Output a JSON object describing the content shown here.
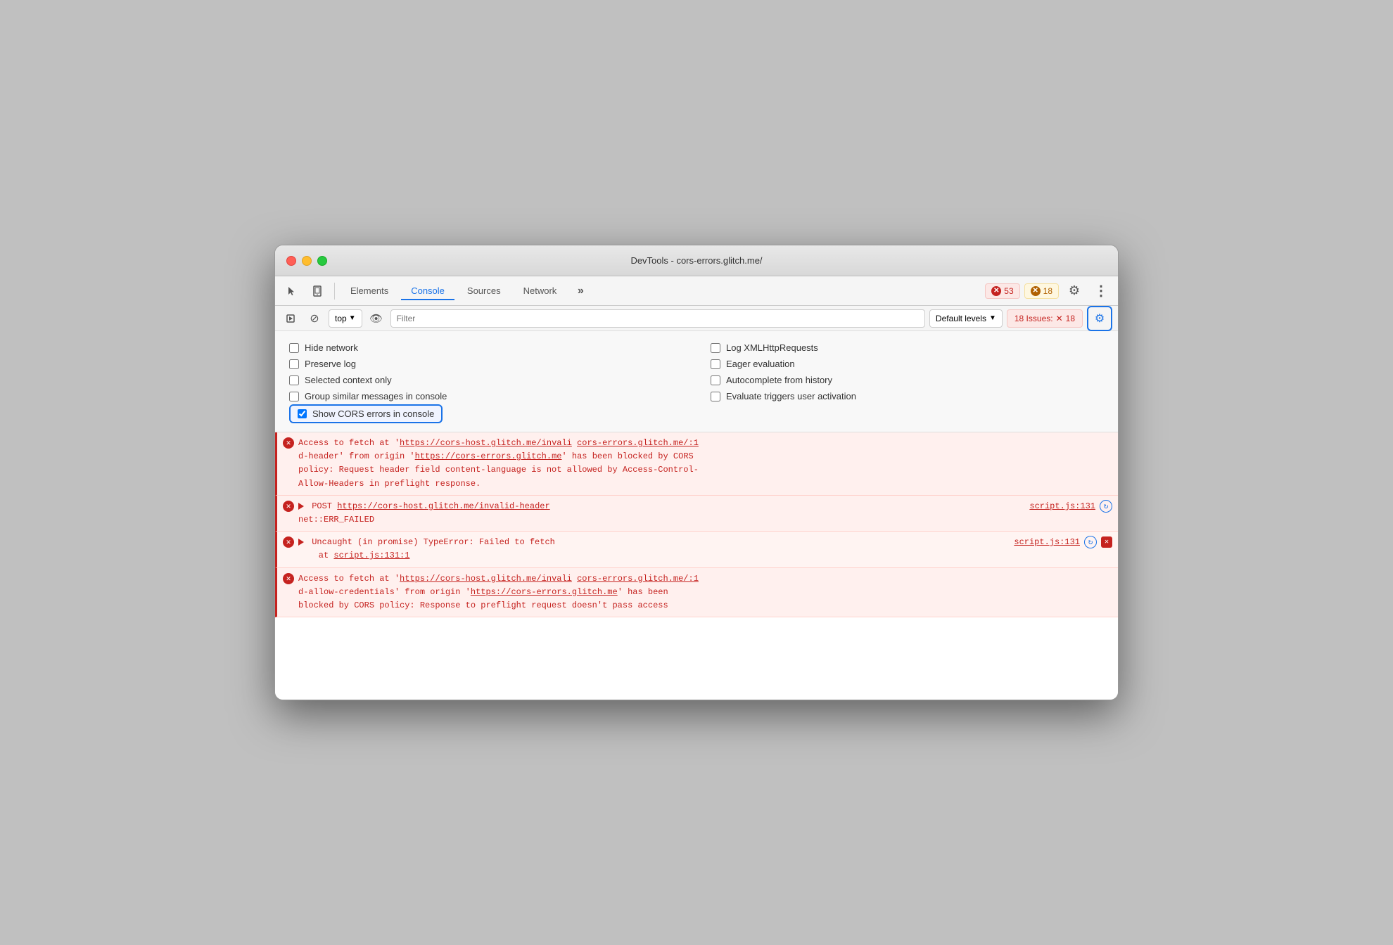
{
  "window": {
    "title": "DevTools - cors-errors.glitch.me/"
  },
  "toolbar": {
    "tabs": [
      "Elements",
      "Console",
      "Sources",
      "Network"
    ],
    "active_tab": "Console",
    "more_tabs_label": "»",
    "badge_errors": "53",
    "badge_warnings": "18",
    "gear_label": "⚙",
    "more_label": "⋮"
  },
  "console_toolbar": {
    "play_icon": "▶",
    "block_icon": "⊘",
    "top_label": "top",
    "eye_icon": "👁",
    "filter_placeholder": "Filter",
    "default_levels_label": "Default levels",
    "issues_label": "18 Issues:",
    "issues_count": "18",
    "gear_icon": "⚙"
  },
  "settings": {
    "hide_network": "Hide network",
    "preserve_log": "Preserve log",
    "selected_context": "Selected context only",
    "group_similar": "Group similar messages in console",
    "show_cors": "Show CORS errors in console",
    "log_xml": "Log XMLHttpRequests",
    "eager_eval": "Eager evaluation",
    "autocomplete": "Autocomplete from history",
    "eval_triggers": "Evaluate triggers user activation",
    "hide_network_checked": false,
    "preserve_log_checked": false,
    "selected_context_checked": false,
    "group_similar_checked": false,
    "show_cors_checked": true,
    "log_xml_checked": false,
    "eager_eval_checked": false,
    "autocomplete_checked": false,
    "eval_triggers_checked": false
  },
  "errors": [
    {
      "type": "error",
      "text_parts": [
        {
          "type": "text",
          "content": "Access to fetch at '"
        },
        {
          "type": "link",
          "content": "https://cors-host.glitch.me/invali"
        },
        {
          "type": "link2",
          "content": "cors-errors.glitch.me/:1"
        },
        {
          "type": "text",
          "content": "d-header' from origin '"
        },
        {
          "type": "link",
          "content": "https://cors-errors.glitch.me"
        },
        {
          "type": "text",
          "content": "' has been blocked by CORS policy: Request header field content-language is not allowed by Access-Control-Allow-Headers in preflight response."
        }
      ],
      "full_text": "Access to fetch at 'https://cors-host.glitch.me/invali cors-errors.glitch.me/:1\nd-header' from origin 'https://cors-errors.glitch.me' has been blocked by CORS policy: Request header field content-language is not allowed by Access-Control-Allow-Headers in preflight response."
    },
    {
      "type": "error",
      "post_text": "POST https://cors-host.glitch.me/invalid-header",
      "sub_text": "net::ERR_FAILED",
      "source": "script.js:131",
      "has_refresh": true,
      "has_close": false
    },
    {
      "type": "error",
      "main_text": "Uncaught (in promise) TypeError: Failed to fetch",
      "sub_text": "at script.js:131:1",
      "source": "script.js:131",
      "has_refresh": true,
      "has_close": true
    },
    {
      "type": "error",
      "full_text": "Access to fetch at 'https://cors-host.glitch.me/invali cors-errors.glitch.me/:1\nd-allow-credentials' from origin 'https://cors-errors.glitch.me' has been blocked by CORS policy: Response to preflight request doesn't pass access"
    }
  ],
  "colors": {
    "error_bg": "#fff0ee",
    "error_text": "#c5221f",
    "error_border": "#ffd2cc",
    "active_tab": "#1a73e8",
    "highlight_border": "#1a73e8"
  }
}
